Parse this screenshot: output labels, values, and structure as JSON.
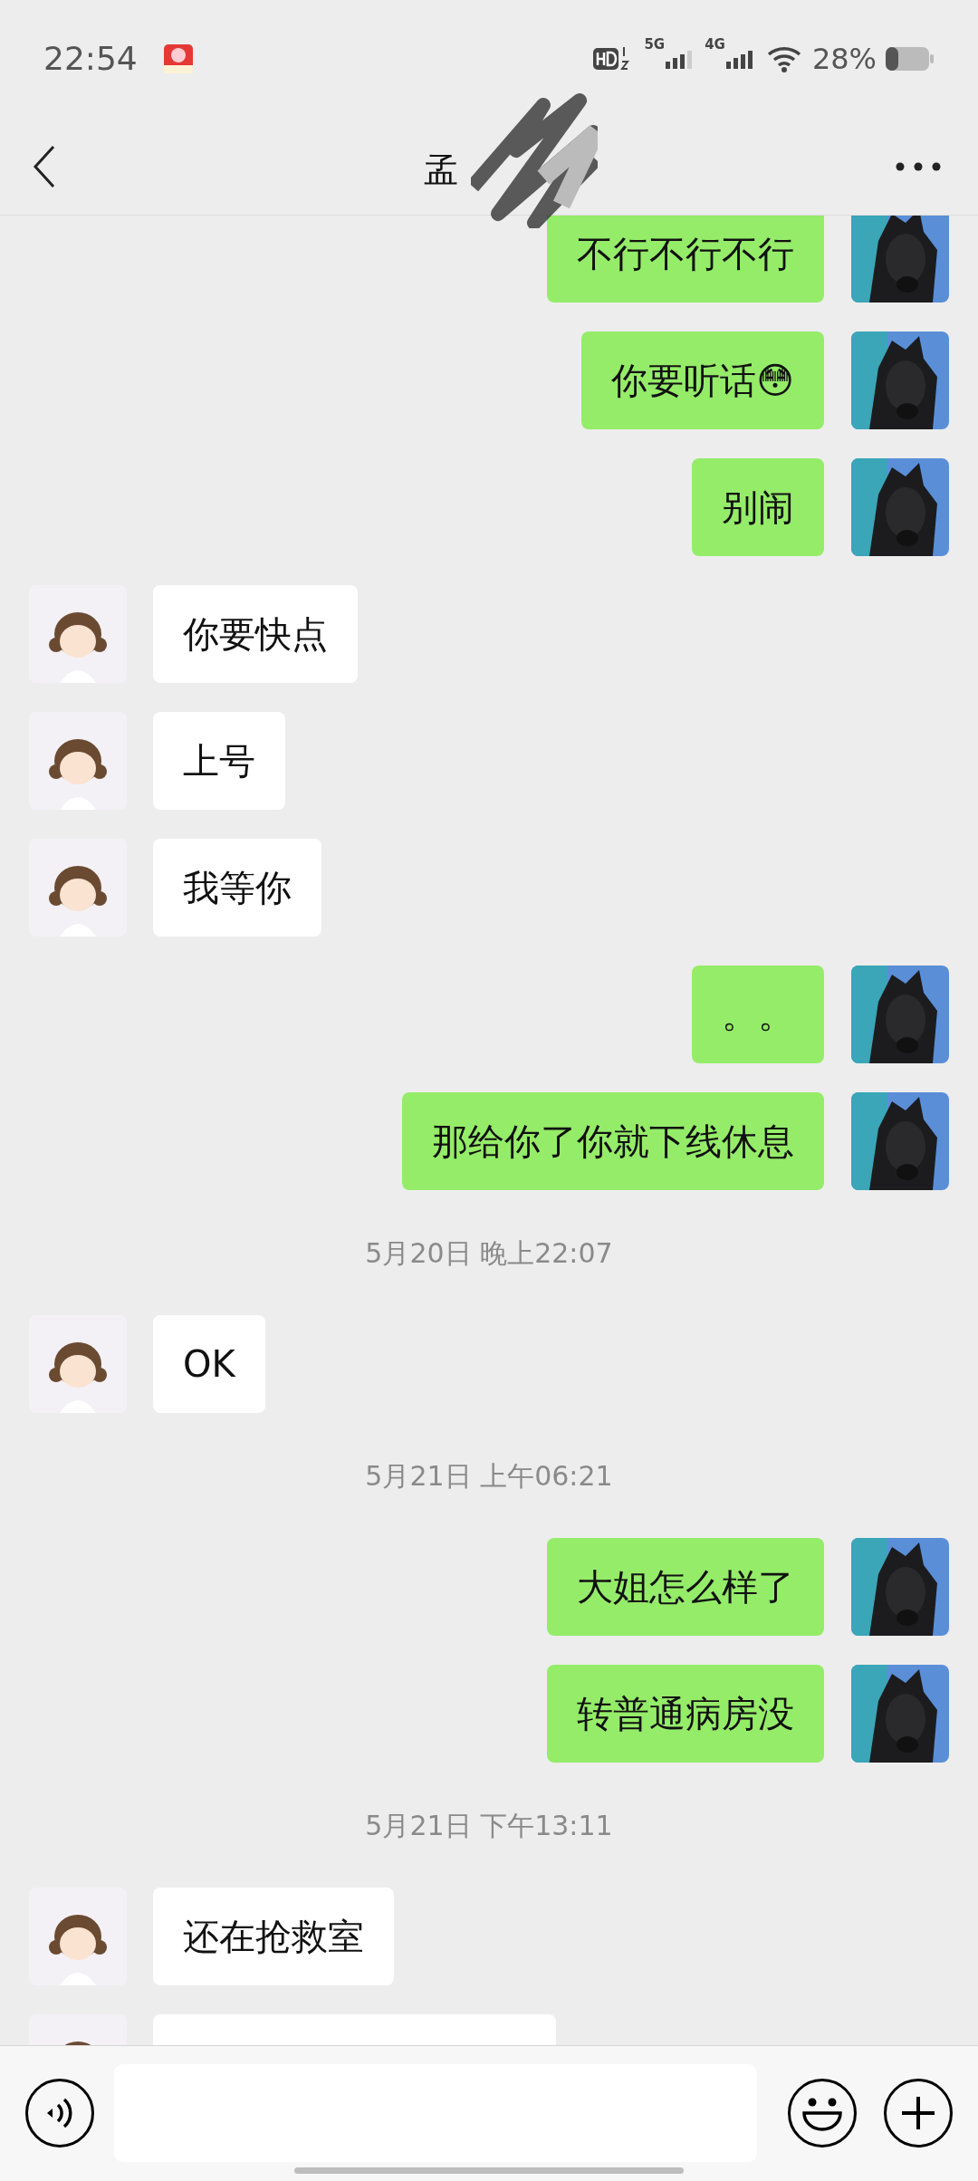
{
  "status_bar": {
    "time": "22:54",
    "networks": [
      "5G",
      "4G"
    ],
    "battery": "28%"
  },
  "header": {
    "title": "孟"
  },
  "messages": [
    {
      "kind": "outgoing",
      "text": "不行不行不行"
    },
    {
      "kind": "outgoing",
      "text": "你要听话😳"
    },
    {
      "kind": "outgoing",
      "text": "别闹"
    },
    {
      "kind": "incoming",
      "text": "你要快点"
    },
    {
      "kind": "incoming",
      "text": "上号"
    },
    {
      "kind": "incoming",
      "text": "我等你"
    },
    {
      "kind": "outgoing",
      "text": "。。"
    },
    {
      "kind": "outgoing",
      "text": "那给你了你就下线休息"
    },
    {
      "kind": "time",
      "text": "5月20日 晚上22:07"
    },
    {
      "kind": "incoming",
      "text": "OK"
    },
    {
      "kind": "time",
      "text": "5月21日 上午06:21"
    },
    {
      "kind": "outgoing",
      "text": "大姐怎么样了"
    },
    {
      "kind": "outgoing",
      "text": "转普通病房没"
    },
    {
      "kind": "time",
      "text": "5月21日 下午13:11"
    },
    {
      "kind": "incoming",
      "text": "还在抢救室"
    },
    {
      "kind": "incoming"
    }
  ]
}
